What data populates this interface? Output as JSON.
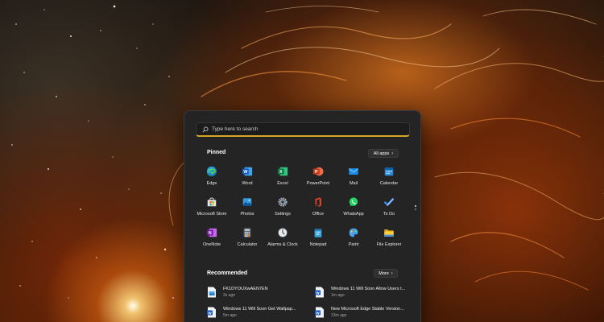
{
  "search": {
    "placeholder": "Type here to search"
  },
  "pinned": {
    "title": "Pinned",
    "all_apps_label": "All apps",
    "apps": [
      {
        "label": "Edge",
        "icon": "edge-icon"
      },
      {
        "label": "Word",
        "icon": "word-icon"
      },
      {
        "label": "Excel",
        "icon": "excel-icon"
      },
      {
        "label": "PowerPoint",
        "icon": "powerpoint-icon"
      },
      {
        "label": "Mail",
        "icon": "mail-icon"
      },
      {
        "label": "Calendar",
        "icon": "calendar-icon"
      },
      {
        "label": "Microsoft Store",
        "icon": "store-icon"
      },
      {
        "label": "Photos",
        "icon": "photos-icon"
      },
      {
        "label": "Settings",
        "icon": "gear-icon"
      },
      {
        "label": "Office",
        "icon": "office-icon"
      },
      {
        "label": "WhatsApp",
        "icon": "whatsapp-icon"
      },
      {
        "label": "To Do",
        "icon": "todo-icon"
      },
      {
        "label": "OneNote",
        "icon": "onenote-icon"
      },
      {
        "label": "Calculator",
        "icon": "calculator-icon"
      },
      {
        "label": "Alarms & Clock",
        "icon": "clock-icon"
      },
      {
        "label": "Notepad",
        "icon": "notepad-icon"
      },
      {
        "label": "Paint",
        "icon": "paint-icon"
      },
      {
        "label": "File Explorer",
        "icon": "folder-icon"
      }
    ]
  },
  "recommended": {
    "title": "Recommended",
    "more_label": "More",
    "items": [
      {
        "name": "FK1DYOUXwAEN7EN",
        "time": "2s ago",
        "icon": "image-file-icon"
      },
      {
        "name": "Windows 11 Will Soon Allow Users t...",
        "time": "1m ago",
        "icon": "word-doc-icon"
      },
      {
        "name": "Windows 11 Will Soon Get Wallpap...",
        "time": "5m ago",
        "icon": "word-doc-icon"
      },
      {
        "name": "New Microsoft Edge Stable Version...",
        "time": "13m ago",
        "icon": "word-doc-icon"
      }
    ]
  },
  "colors": {
    "search_underline": "#d8a72a",
    "menu_bg": "#242424"
  }
}
